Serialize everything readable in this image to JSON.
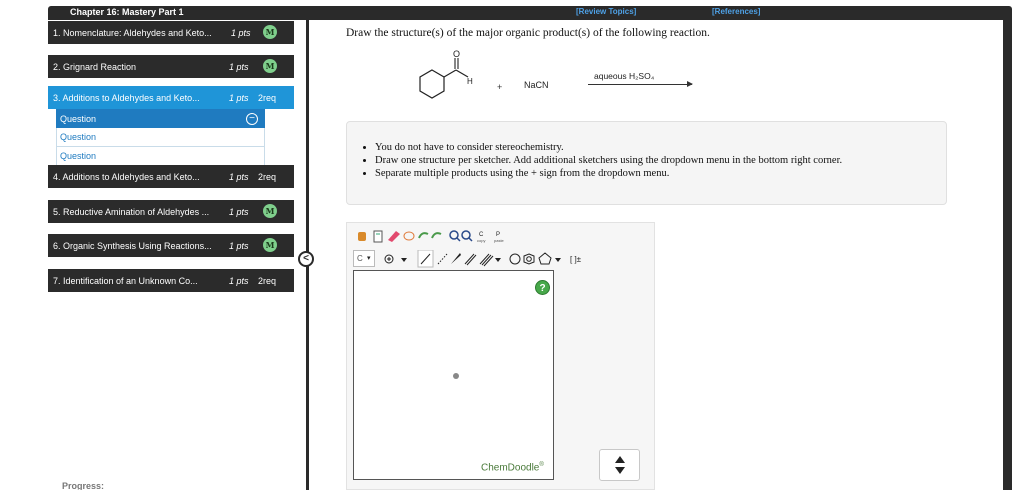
{
  "header": {
    "chapter": "Chapter 16: Mastery Part 1",
    "review_topics": "[Review Topics]",
    "references": "[References]"
  },
  "sidebar": {
    "items": [
      {
        "label": "1. Nomenclature: Aldehydes and Keto...",
        "pts": "1 pts",
        "badge": "M"
      },
      {
        "label": "2. Grignard Reaction",
        "pts": "1 pts",
        "badge": "M"
      },
      {
        "label": "3. Additions to Aldehydes and Keto...",
        "pts": "1 pts",
        "req": "2req"
      },
      {
        "label": "4. Additions to Aldehydes and Keto...",
        "pts": "1 pts",
        "req": "2req"
      },
      {
        "label": "5. Reductive Amination of Aldehydes ...",
        "pts": "1 pts",
        "badge": "M"
      },
      {
        "label": "6. Organic Synthesis Using Reactions...",
        "pts": "1 pts",
        "badge": "M"
      },
      {
        "label": "7. Identification of an Unknown Co...",
        "pts": "1 pts",
        "req": "2req"
      }
    ],
    "subquestions": [
      "Question",
      "Question",
      "Question"
    ],
    "progress": "Progress:"
  },
  "main": {
    "question": "Draw the structure(s) of the major organic product(s) of the following reaction.",
    "reactant_atom_o": "O",
    "reactant_atom_h": "H",
    "plus": "+",
    "reagent": "NaCN",
    "conditions": "aqueous H₂SO₄",
    "notes": [
      "You do not have to consider stereochemistry.",
      "Draw one structure per sketcher. Add additional sketchers using the dropdown menu in the bottom right corner.",
      "Separate multiple products using the + sign from the dropdown menu."
    ]
  },
  "sketcher": {
    "element_select": "C",
    "help": "?",
    "brand": "ChemDoodle",
    "brand_mark": "®",
    "copy_label": "C",
    "copy_sub": "copy",
    "paste_label": "P",
    "paste_sub": "paste",
    "bracket_label": "[ ]±"
  },
  "colors": {
    "dark_bar": "#2a2a2a",
    "active_blue": "#1f95d8",
    "link_blue": "#4ea1e6",
    "badge_green": "#7fcf8c"
  }
}
